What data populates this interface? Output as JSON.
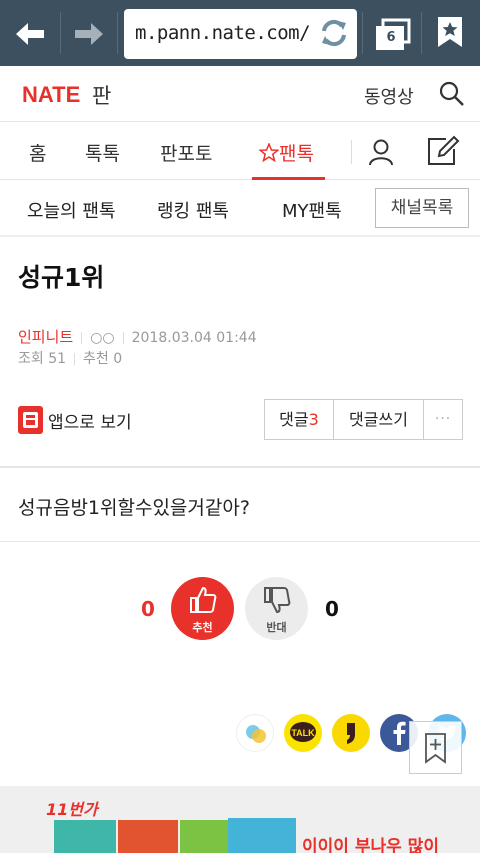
{
  "browser": {
    "url": "m.pann.nate.com/",
    "tab_count": "6"
  },
  "header": {
    "logo": "NATE",
    "logo_sub": "판",
    "video_label": "동영상"
  },
  "gnb": {
    "items": [
      "홈",
      "톡톡",
      "판포토",
      "팬톡"
    ]
  },
  "subnav": {
    "items": [
      "오늘의 팬톡",
      "랭킹 팬톡",
      "MY팬톡"
    ],
    "channel_button": "채널목록"
  },
  "post": {
    "title": "성규1위",
    "author": "인피니트",
    "author_extra": "○○",
    "datetime": "2018.03.04 01:44",
    "views_label": "조회",
    "views": "51",
    "recommend_label": "추천",
    "recommend": "0",
    "app_view": "앱으로 보기",
    "comment_label": "댓글",
    "comment_count": "3",
    "write_comment": "댓글쓰기",
    "more": "···",
    "body": "성규음방1위할수있을거같아?"
  },
  "votes": {
    "up_count": "0",
    "up_label": "추천",
    "down_count": "0",
    "down_label": "반대"
  },
  "share": {
    "kakaotalk_label": "TALK"
  },
  "ad": {
    "brand": "11번가",
    "text": "이이이 부나우 많이"
  },
  "colors": {
    "accent": "#e8312a",
    "toolbar": "#3d5060"
  }
}
